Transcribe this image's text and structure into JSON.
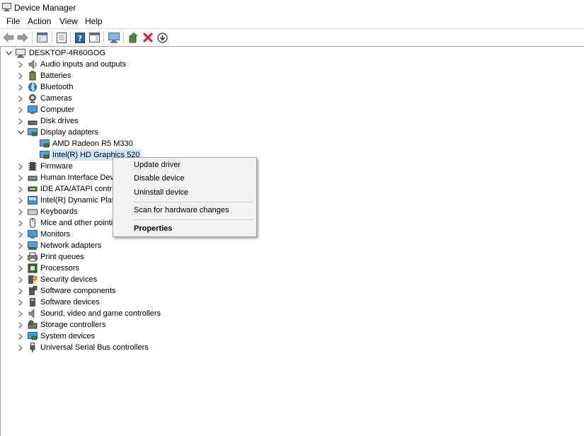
{
  "window": {
    "title": "Device Manager"
  },
  "menu": [
    "File",
    "Action",
    "View",
    "Help"
  ],
  "toolbar": {
    "buttons": [
      "back-icon",
      "forward-icon",
      "show-hide-console-tree-icon",
      "properties-icon",
      "help-icon",
      "action-pane-icon",
      "scan-hardware-icon",
      "update-driver-icon",
      "uninstall-icon",
      "download-icon"
    ]
  },
  "tree": {
    "root": "DESKTOP-4R60GOG",
    "categories": [
      "Audio inputs and outputs",
      "Batteries",
      "Bluetooth",
      "Cameras",
      "Computer",
      "Disk drives",
      "Display adapters",
      "Firmware",
      "Human Interface Devi",
      "IDE ATA/ATAPI control",
      "Intel(R) Dynamic Platf",
      "Keyboards",
      "Mice and other pointi",
      "Monitors",
      "Network adapters",
      "Print queues",
      "Processors",
      "Security devices",
      "Software components",
      "Software devices",
      "Sound, video and game controllers",
      "Storage controllers",
      "System devices",
      "Universal Serial Bus controllers"
    ],
    "display_children": [
      "AMD Radeon R5 M330",
      "Intel(R) HD Graphics 520"
    ]
  },
  "context_menu": {
    "update": "Update driver",
    "disable": "Disable device",
    "uninstall": "Uninstall device",
    "scan": "Scan for hardware changes",
    "properties": "Properties"
  },
  "colors": {
    "selection": "#cce8ff",
    "menu_bg": "#f2f2f2",
    "delete_red": "#e81123"
  }
}
